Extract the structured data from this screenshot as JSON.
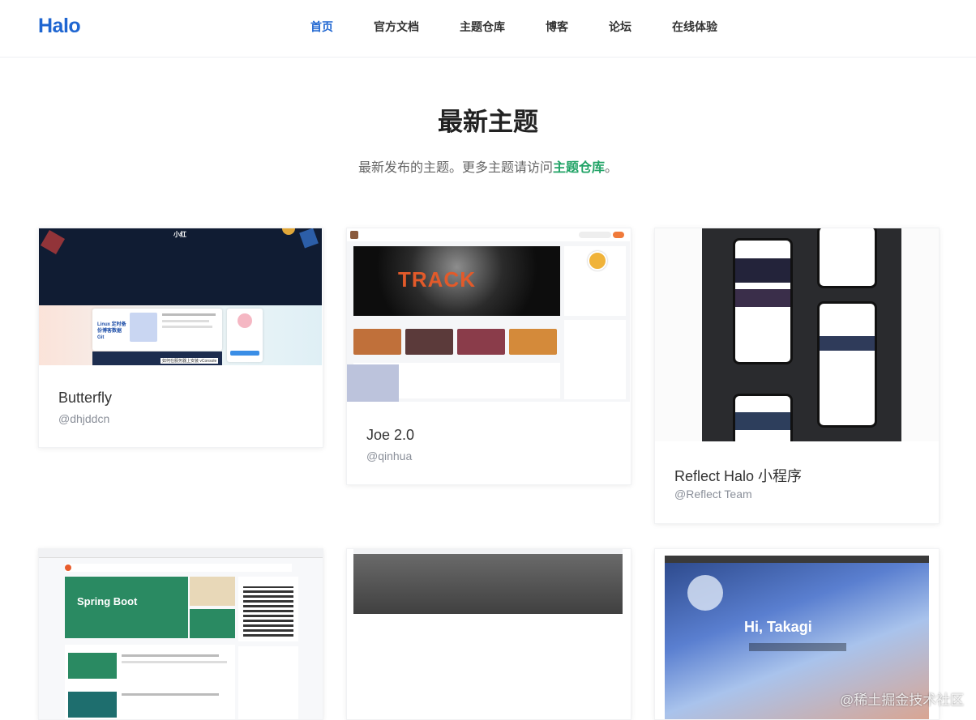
{
  "header": {
    "logo": "Halo",
    "nav": [
      {
        "label": "首页",
        "active": true
      },
      {
        "label": "官方文档"
      },
      {
        "label": "主题仓库"
      },
      {
        "label": "博客"
      },
      {
        "label": "论坛"
      },
      {
        "label": "在线体验"
      }
    ]
  },
  "hero": {
    "title": "最新主题",
    "subtitle_prefix": "最新发布的主题。更多主题请访问",
    "subtitle_link": "主题仓库",
    "subtitle_suffix": "。"
  },
  "themes": [
    {
      "name": "Butterfly",
      "author": "@dhjddcn",
      "thumb_texts": {
        "title": "小红",
        "banner": "Linux 定时备份博客数据Git",
        "snippet": "如何在服务器上安装 vConsole"
      }
    },
    {
      "name": "Joe 2.0",
      "author": "@qinhua",
      "thumb_texts": {
        "banner": "TRACK"
      }
    },
    {
      "name": "Reflect Halo 小程序",
      "author": "@Reflect Team"
    },
    {
      "name": "",
      "author": "",
      "thumb_texts": {
        "banner": "Spring Boot"
      }
    },
    {
      "name": "",
      "author": ""
    },
    {
      "name": "",
      "author": "",
      "thumb_texts": {
        "banner": "Hi, Takagi"
      }
    }
  ],
  "watermark": "@稀土掘金技术社区",
  "colors": {
    "accent": "#1f66d1",
    "link": "#21a366"
  }
}
